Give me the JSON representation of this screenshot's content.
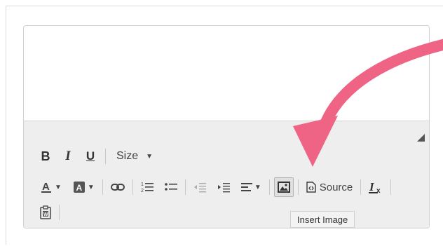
{
  "toolbar": {
    "size_label": "Size",
    "source_label": "Source"
  },
  "tooltip": {
    "text": "Insert Image"
  },
  "icons": {
    "bold": "bold-icon",
    "italic": "italic-icon",
    "underline": "underline-icon",
    "text_color": "text-color-icon",
    "bg_color": "background-color-icon",
    "link": "link-icon",
    "numbered_list": "numbered-list-icon",
    "bulleted_list": "bulleted-list-icon",
    "outdent": "outdent-icon",
    "indent": "indent-icon",
    "align": "align-icon",
    "image": "image-icon",
    "source": "source-icon",
    "remove_format": "remove-format-icon",
    "paste": "paste-from-word-icon"
  },
  "colors": {
    "annotation_arrow": "#ef6485",
    "toolbar_bg": "#eeeeee"
  }
}
